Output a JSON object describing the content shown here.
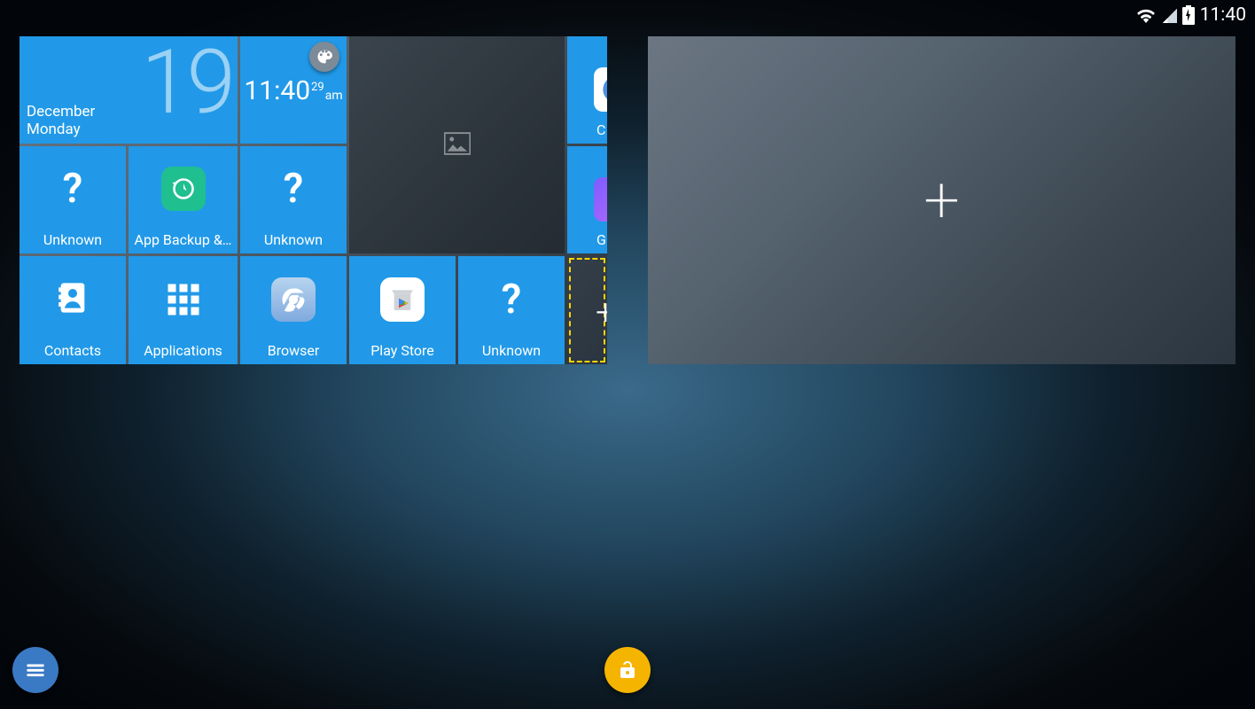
{
  "status": {
    "time": "11:40"
  },
  "panel1": {
    "date": {
      "day": "19",
      "month": "December",
      "weekday": "Monday"
    },
    "clock": {
      "hm": "11:40",
      "sec": "29",
      "ampm": "am"
    },
    "row2": {
      "a": "Unknown",
      "b": "App Backup &…",
      "c": "Unknown"
    },
    "row3": {
      "a": "Contacts",
      "b": "Applications",
      "c": "Browser",
      "d": "Play Store",
      "e": "Unknown"
    },
    "partial": {
      "p1": "C",
      "p2": "G"
    }
  }
}
